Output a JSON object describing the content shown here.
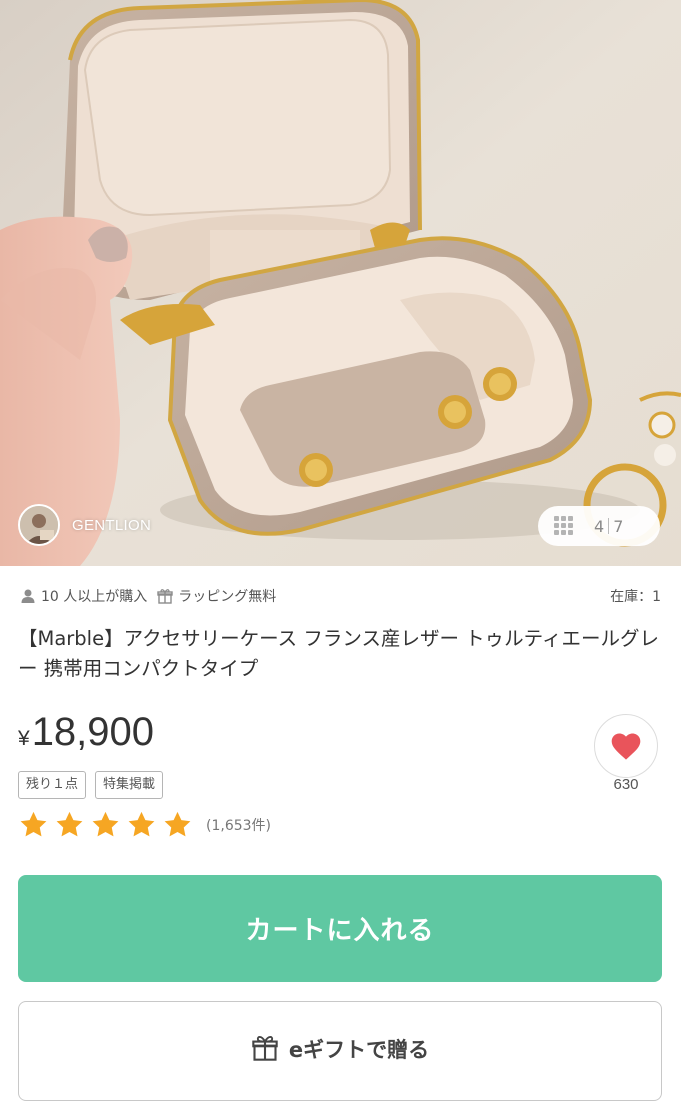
{
  "gallery": {
    "current": "4",
    "total": "7",
    "shop_name": "GENTLION"
  },
  "meta": {
    "buyers": "10 人以上が購入",
    "wrapping": "ラッピング無料",
    "stock": "在庫：1"
  },
  "product": {
    "title": "【Marble】アクセサリーケース フランス産レザー トゥルティエールグレー 携帯用コンパクトタイプ",
    "currency": "¥",
    "price": "18,900",
    "tags": [
      "残り１点",
      "特集掲載"
    ],
    "rating": 5,
    "review_count": "(1,653件)",
    "favorites": "630"
  },
  "actions": {
    "cart": "カートに入れる",
    "gift": "eギフトで贈る"
  },
  "colors": {
    "accent_green": "#5fc8a2",
    "star_orange": "#f6a623",
    "heart_red": "#e9545b"
  }
}
